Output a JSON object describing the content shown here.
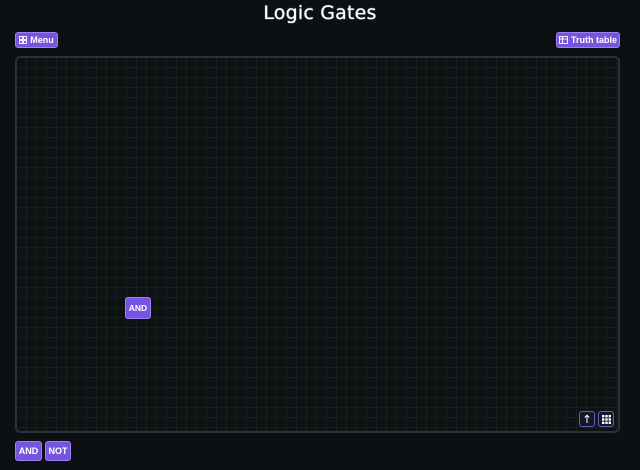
{
  "app": {
    "title": "Logic Gates"
  },
  "toolbar": {
    "menu_label": "Menu",
    "menu_icon": "grid-icon",
    "truth_table_label": "Truth table",
    "truth_table_icon": "table-icon"
  },
  "canvas": {
    "gates": [
      {
        "label": "AND"
      }
    ],
    "controls": [
      {
        "icon": "arrow-up-icon"
      },
      {
        "icon": "grid-dots-icon"
      }
    ]
  },
  "palette": {
    "items": [
      {
        "label": "AND"
      },
      {
        "label": "NOT"
      }
    ]
  },
  "colors": {
    "background": "#0d1013",
    "accent": "#7654df",
    "accent_border": "#9a82f0",
    "canvas_background": "#0e1215",
    "grid_line": "#162019",
    "canvas_border": "#2b3136",
    "text": "#ffffff"
  }
}
